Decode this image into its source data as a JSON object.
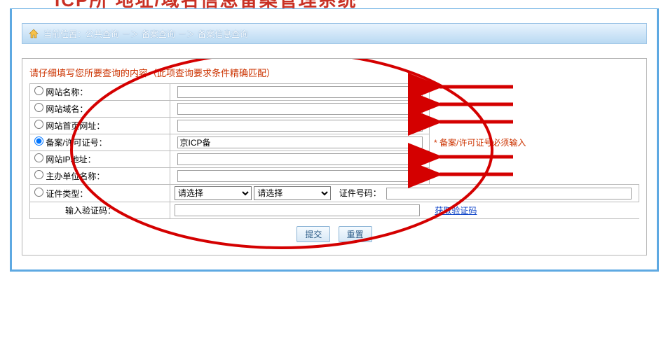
{
  "page": {
    "top_title_fragment": "ICP所 地址/域名信息备案管理系统"
  },
  "breadcrumb": {
    "label_current": "当前位置：公共查询",
    "arrow": "－＞",
    "crumb1": "备案查询",
    "crumb2": "备案信息查询"
  },
  "form": {
    "instruction": "请仔细填写您所要查询的内容（此项查询要求条件精确匹配）",
    "rows": {
      "site_name": {
        "label": "网站名称：",
        "value": ""
      },
      "domain": {
        "label": "网站域名：",
        "value": ""
      },
      "homepage": {
        "label": "网站首页网址：",
        "value": ""
      },
      "license": {
        "label": "备案/许可证号：",
        "value": "京ICP备",
        "note": "* 备案/许可证号必须输入"
      },
      "ip": {
        "label": "网站IP地址：",
        "value": ""
      },
      "org": {
        "label": "主办单位名称：",
        "value": ""
      },
      "doc_type": {
        "label": "证件类型：",
        "select_placeholder": "请选择",
        "doc_num_label": "证件号码：",
        "doc_num_value": ""
      },
      "captcha": {
        "label": "输入验证码：",
        "link": "获取验证码"
      }
    },
    "buttons": {
      "submit": "提交",
      "reset": "重置"
    }
  }
}
